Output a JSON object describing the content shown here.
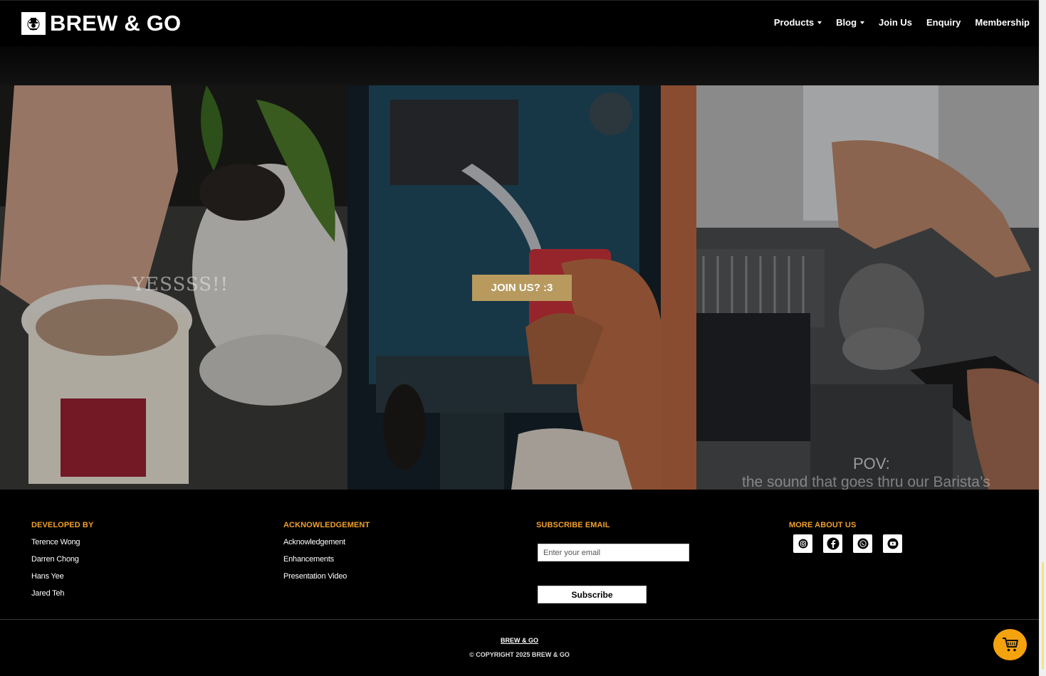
{
  "brand": {
    "name": "BREW & GO"
  },
  "nav": {
    "items": [
      {
        "label": "Products",
        "dropdown": true
      },
      {
        "label": "Blog",
        "dropdown": true
      },
      {
        "label": "Join Us",
        "dropdown": false
      },
      {
        "label": "Enquiry",
        "dropdown": false
      },
      {
        "label": "Membership",
        "dropdown": false
      }
    ]
  },
  "gallery": {
    "panel1": {
      "caption": "YESSSS!!"
    },
    "panel2": {
      "button_label": "JOIN US? :3"
    },
    "panel3": {
      "caption_line1": "POV:",
      "caption_line2": "the sound that goes thru our Barista’s"
    }
  },
  "footer": {
    "developed_by": {
      "heading": "DEVELOPED BY",
      "names": [
        "Terence Wong",
        "Darren Chong",
        "Hans Yee",
        "Jared Teh"
      ]
    },
    "acknowledgement": {
      "heading": "ACKNOWLEDGEMENT",
      "links": [
        "Acknowledgement",
        "Enhancements",
        "Presentation Video"
      ]
    },
    "subscribe": {
      "heading": "SUBSCRIBE EMAIL",
      "placeholder": "Enter your email",
      "button_label": "Subscribe"
    },
    "more_about": {
      "heading": "MORE ABOUT US",
      "icons": [
        "instagram-icon",
        "facebook-icon",
        "whatsapp-icon",
        "youtube-icon"
      ]
    },
    "bottom": {
      "brand": "BREW & GO",
      "copyright": "© COPYRIGHT 2025 BREW & GO"
    }
  },
  "colors": {
    "accent": "#f0a02a",
    "button_gold": "#b89a5f",
    "cart": "#f5a20f"
  }
}
